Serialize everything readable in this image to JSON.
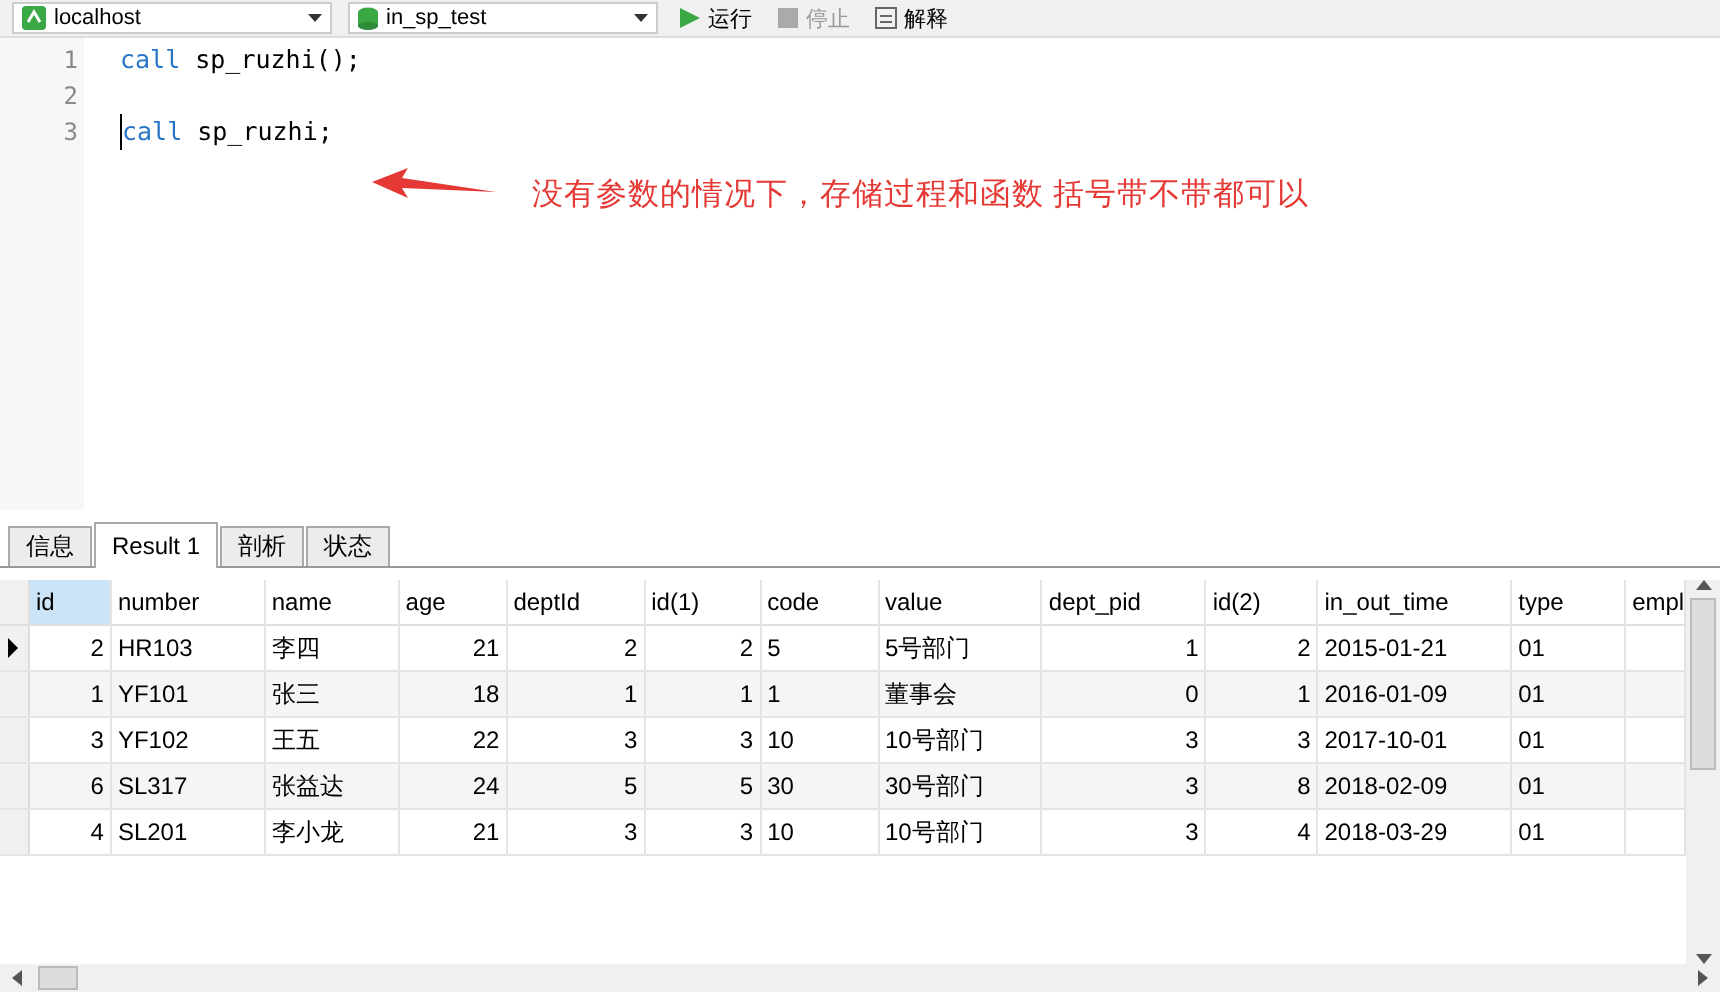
{
  "toolbar": {
    "connection": "localhost",
    "database": "in_sp_test",
    "buttons": [
      {
        "label": "运行",
        "kind": "run",
        "disabled": false
      },
      {
        "label": "停止",
        "kind": "stop",
        "disabled": true
      },
      {
        "label": "解释",
        "kind": "explain",
        "disabled": false
      }
    ]
  },
  "editor": {
    "lines": [
      {
        "number": "1",
        "keyword": "call",
        "code": " sp_ruzhi();",
        "cursor": false
      },
      {
        "number": "2",
        "cursor": false
      },
      {
        "number": "3",
        "keyword": "call",
        "code": " sp_ruzhi;",
        "cursor": true
      }
    ],
    "annotation": "没有参数的情况下，存储过程和函数 括号带不带都可以"
  },
  "tabs": [
    {
      "label": "信息",
      "selected": false
    },
    {
      "label": "Result 1",
      "selected": true
    },
    {
      "label": "剖析",
      "selected": false
    },
    {
      "label": "状态",
      "selected": false
    }
  ],
  "table": {
    "columns": [
      {
        "label": "id",
        "kind": "number",
        "selected": true
      },
      {
        "label": "number",
        "kind": "text",
        "selected": false
      },
      {
        "label": "name",
        "kind": "text",
        "selected": false
      },
      {
        "label": "age",
        "kind": "number",
        "selected": false
      },
      {
        "label": "deptId",
        "kind": "number",
        "selected": false
      },
      {
        "label": "id(1)",
        "kind": "number",
        "selected": false
      },
      {
        "label": "code",
        "kind": "text",
        "selected": false
      },
      {
        "label": "value",
        "kind": "text",
        "selected": false
      },
      {
        "label": "dept_pid",
        "kind": "number",
        "selected": false
      },
      {
        "label": "id(2)",
        "kind": "number",
        "selected": false
      },
      {
        "label": "in_out_time",
        "kind": "text",
        "selected": false
      },
      {
        "label": "type",
        "kind": "text",
        "selected": false
      },
      {
        "label": "empl",
        "kind": "text",
        "selected": false
      }
    ],
    "rows": [
      {
        "selected": true,
        "cells": [
          "2",
          "HR103",
          "李四",
          "21",
          "2",
          "2",
          "5",
          "5号部门",
          "1",
          "2",
          "2015-01-21",
          "01",
          ""
        ]
      },
      {
        "selected": false,
        "cells": [
          "1",
          "YF101",
          "张三",
          "18",
          "1",
          "1",
          "1",
          "董事会",
          "0",
          "1",
          "2016-01-09",
          "01",
          ""
        ]
      },
      {
        "selected": false,
        "cells": [
          "3",
          "YF102",
          "王五",
          "22",
          "3",
          "3",
          "10",
          "10号部门",
          "3",
          "3",
          "2017-10-01",
          "01",
          ""
        ]
      },
      {
        "selected": false,
        "cells": [
          "6",
          "SL317",
          "张益达",
          "24",
          "5",
          "5",
          "30",
          "30号部门",
          "3",
          "8",
          "2018-02-09",
          "01",
          ""
        ]
      },
      {
        "selected": false,
        "cells": [
          "4",
          "SL201",
          "李小龙",
          "21",
          "3",
          "3",
          "10",
          "10号部门",
          "3",
          "4",
          "2018-03-29",
          "01",
          ""
        ]
      }
    ]
  }
}
